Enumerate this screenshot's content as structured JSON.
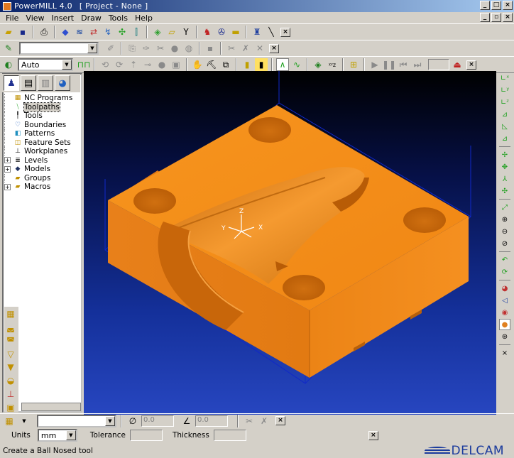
{
  "window": {
    "app_name": "PowerMILL 4.0",
    "project": "[ Project - None ]"
  },
  "menu": [
    "File",
    "View",
    "Insert",
    "Draw",
    "Tools",
    "Help"
  ],
  "toolbar3": {
    "mode_select": "Auto"
  },
  "tree": [
    {
      "label": "NC Programs",
      "expandable": false,
      "icon": "nc-programs-icon"
    },
    {
      "label": "Toolpaths",
      "expandable": false,
      "icon": "toolpaths-icon",
      "selected": true
    },
    {
      "label": "Tools",
      "expandable": false,
      "icon": "tools-icon"
    },
    {
      "label": "Boundaries",
      "expandable": false,
      "icon": "boundaries-icon"
    },
    {
      "label": "Patterns",
      "expandable": false,
      "icon": "patterns-icon"
    },
    {
      "label": "Feature Sets",
      "expandable": false,
      "icon": "feature-sets-icon"
    },
    {
      "label": "Workplanes",
      "expandable": false,
      "icon": "workplanes-icon"
    },
    {
      "label": "Levels",
      "expandable": true,
      "icon": "levels-icon"
    },
    {
      "label": "Models",
      "expandable": true,
      "icon": "models-icon"
    },
    {
      "label": "Groups",
      "expandable": false,
      "icon": "groups-icon"
    },
    {
      "label": "Macros",
      "expandable": true,
      "icon": "macros-icon"
    }
  ],
  "viewport": {
    "axis_labels": {
      "x": "X",
      "y": "Y",
      "z": "Z"
    },
    "colors": {
      "part": "#f08a1c",
      "part_dark": "#c96a0a",
      "part_side": "#e07a14",
      "bbox": "#1028c8"
    }
  },
  "bottombar1": {
    "diameter_value": "0.0",
    "angle_value": "0.0"
  },
  "bottombar2": {
    "units_label": "Units",
    "units_value": "mm",
    "tolerance_label": "Tolerance",
    "thickness_label": "Thickness"
  },
  "status": {
    "message": "Create a Ball Nosed tool",
    "brand": "DELCAM"
  }
}
